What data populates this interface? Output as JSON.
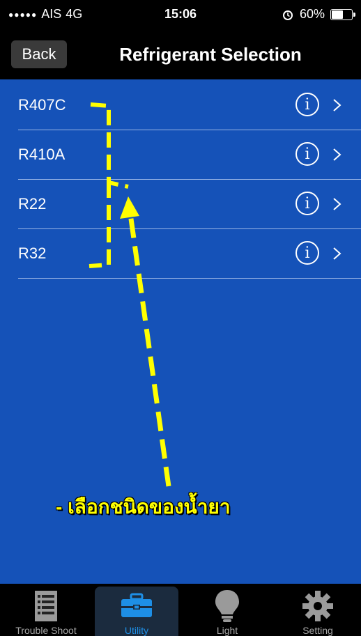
{
  "status_bar": {
    "carrier": "AIS",
    "network": "4G",
    "time": "15:06",
    "battery": "60%",
    "battery_level": 0.6
  },
  "nav": {
    "back_label": "Back",
    "title": "Refrigerant Selection"
  },
  "refrigerants": [
    {
      "label": "R407C",
      "info_icon": "info-icon",
      "chevron": ">"
    },
    {
      "label": "R410A",
      "info_icon": "info-icon",
      "chevron": ">"
    },
    {
      "label": "R22",
      "info_icon": "info-icon",
      "chevron": ">"
    },
    {
      "label": "R32",
      "info_icon": "info-icon",
      "chevron": ">"
    }
  ],
  "annotation": {
    "text": "- เลือกชนิดของน้ำยา",
    "color": "#ffff00"
  },
  "tabs": [
    {
      "label": "Trouble Shoot",
      "icon": "list-icon",
      "active": false
    },
    {
      "label": "Utility",
      "icon": "toolbox-icon",
      "active": true
    },
    {
      "label": "Light",
      "icon": "bulb-icon",
      "active": false
    },
    {
      "label": "Setting",
      "icon": "gear-icon",
      "active": false
    }
  ],
  "colors": {
    "background": "#1552b8",
    "bar": "#000000",
    "active_tab": "#1e8fe6"
  }
}
